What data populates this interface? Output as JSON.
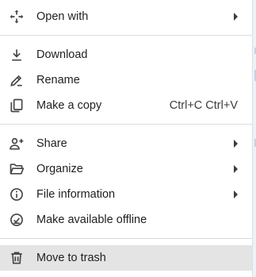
{
  "menu": {
    "items": [
      {
        "label": "Open with",
        "icon": "move-arrows-icon",
        "has_submenu": true
      },
      {
        "label": "Download",
        "icon": "download-icon"
      },
      {
        "label": "Rename",
        "icon": "pencil-icon"
      },
      {
        "label": "Make a copy",
        "icon": "copy-icon",
        "shortcut": "Ctrl+C Ctrl+V"
      },
      {
        "label": "Share",
        "icon": "person-add-icon",
        "has_submenu": true
      },
      {
        "label": "Organize",
        "icon": "folder-open-icon",
        "has_submenu": true
      },
      {
        "label": "File information",
        "icon": "info-icon",
        "has_submenu": true
      },
      {
        "label": "Make available offline",
        "icon": "offline-check-icon"
      },
      {
        "label": "Move to trash",
        "icon": "trash-icon",
        "highlighted": true
      }
    ]
  },
  "colors": {
    "text": "#1f1f1f",
    "icon": "#444746",
    "divider": "#dadce0",
    "highlight": "#e4e4e4"
  }
}
